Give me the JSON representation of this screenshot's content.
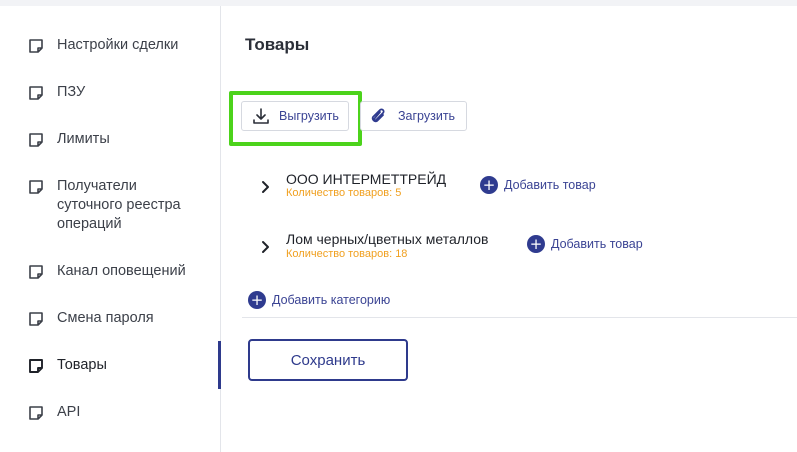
{
  "sidebar": {
    "items": [
      {
        "label": "Настройки сделки",
        "icon": "document-icon"
      },
      {
        "label": "ПЗУ",
        "icon": "document-icon"
      },
      {
        "label": "Лимиты",
        "icon": "document-icon"
      },
      {
        "label": "Получатели суточного реестра операций",
        "icon": "document-icon"
      },
      {
        "label": "Канал оповещений",
        "icon": "document-icon"
      },
      {
        "label": "Смена пароля",
        "icon": "document-icon"
      },
      {
        "label": "Товары",
        "icon": "document-icon",
        "active": true
      },
      {
        "label": "API",
        "icon": "document-icon"
      }
    ]
  },
  "main": {
    "title": "Товары",
    "export_label": "Выгрузить",
    "import_label": "Загрузить",
    "categories": [
      {
        "name": "ООО ИНТЕРМЕТТРЕЙД",
        "count": "Количество товаров: 5",
        "add_label": "Добавить товар"
      },
      {
        "name": "Лом черных/цветных металлов",
        "count": "Количество товаров: 18",
        "add_label": "Добавить товар"
      }
    ],
    "add_category_label": "Добавить категорию",
    "save_label": "Сохранить"
  },
  "colors": {
    "accent": "#2e3a8c",
    "highlight": "#4cd31b",
    "count_text": "#f0a020"
  }
}
